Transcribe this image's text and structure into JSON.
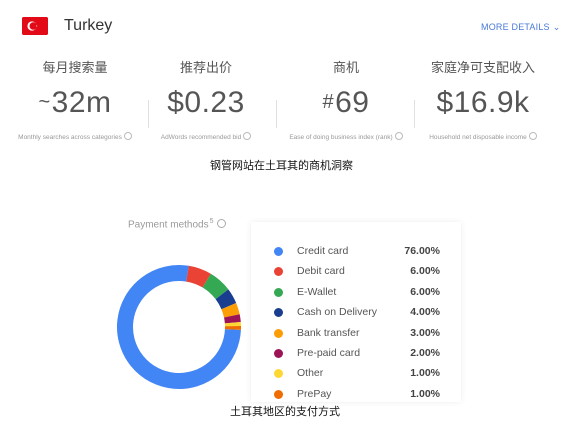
{
  "header": {
    "country": "Turkey",
    "more_details": "MORE DETAILS",
    "flag_color": "#e30a17"
  },
  "stats": [
    {
      "label": "每月搜索量",
      "prefix": "~",
      "value": "32m",
      "desc": "Monthly searches across categories"
    },
    {
      "label": "推荐出价",
      "prefix": "",
      "value": "$0.23",
      "desc": "AdWords recommended bid"
    },
    {
      "label": "商机",
      "prefix": "#",
      "value": "69",
      "desc": "Ease of doing business index (rank)"
    },
    {
      "label": "家庭净可支配收入",
      "prefix": "",
      "value": "$16.9k",
      "desc": "Household net disposable income"
    }
  ],
  "caption_top": "钢管网站在土耳其的商机洞察",
  "payment": {
    "title": "Payment methods",
    "count": "5",
    "methods": [
      {
        "name": "Credit card",
        "pct": "76.00%",
        "value": 76,
        "color": "#4285f4"
      },
      {
        "name": "Debit card",
        "pct": "6.00%",
        "value": 6,
        "color": "#ea4335"
      },
      {
        "name": "E-Wallet",
        "pct": "6.00%",
        "value": 6,
        "color": "#34a853"
      },
      {
        "name": "Cash on Delivery",
        "pct": "4.00%",
        "value": 4,
        "color": "#1a3e8f"
      },
      {
        "name": "Bank transfer",
        "pct": "3.00%",
        "value": 3,
        "color": "#fb9d05"
      },
      {
        "name": "Pre-paid card",
        "pct": "2.00%",
        "value": 2,
        "color": "#9c1456"
      },
      {
        "name": "Other",
        "pct": "1.00%",
        "value": 1,
        "color": "#fdd835"
      },
      {
        "name": "PrePay",
        "pct": "1.00%",
        "value": 1,
        "color": "#ef6c00"
      }
    ]
  },
  "caption_bottom": "土耳其地区的支付方式"
}
